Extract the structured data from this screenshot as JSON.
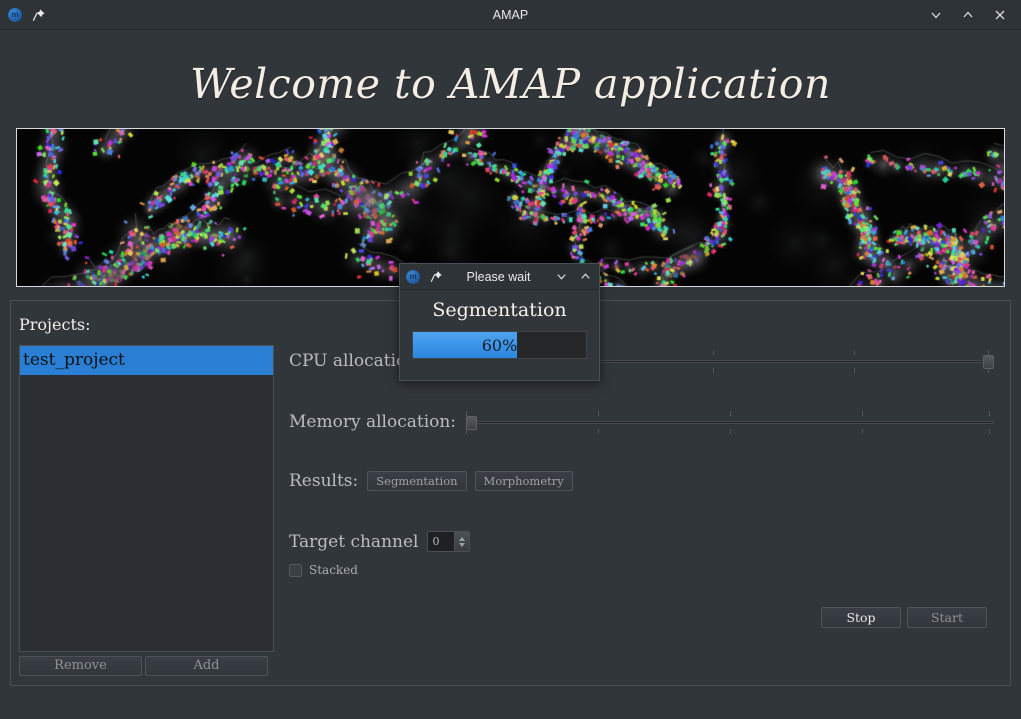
{
  "window": {
    "title": "AMAP",
    "app_icon": "app-logo-icon",
    "pin_icon": "pin-icon",
    "controls": [
      {
        "name": "minimize",
        "icon": "chevron-down-icon"
      },
      {
        "name": "maximize",
        "icon": "chevron-up-icon"
      },
      {
        "name": "close",
        "icon": "close-icon"
      }
    ]
  },
  "welcome": {
    "heading": "Welcome to AMAP application"
  },
  "banner": {
    "alt": "segmented-microscopy-preview"
  },
  "projects": {
    "label": "Projects:",
    "items": [
      {
        "name": "test_project",
        "selected": true
      }
    ],
    "remove_label": "Remove",
    "add_label": "Add"
  },
  "controls": {
    "cpu_label": "CPU allocation:",
    "cpu_value": 100,
    "memory_label": "Memory allocation:",
    "memory_value": 0,
    "results_label": "Results:",
    "results_buttons": [
      {
        "label": "Segmentation"
      },
      {
        "label": "Morphometry"
      }
    ],
    "target_channel_label": "Target channel",
    "target_channel_value": "0",
    "stacked_label": "Stacked",
    "stacked_checked": false,
    "stop_label": "Stop",
    "start_label": "Start"
  },
  "modal": {
    "title": "Please wait",
    "app_icon": "app-logo-icon",
    "pin_icon": "pin-icon",
    "heading": "Segmentation",
    "progress_text": "60%",
    "progress_percent": 60,
    "controls": [
      {
        "name": "minimize",
        "icon": "chevron-down-icon"
      },
      {
        "name": "maximize",
        "icon": "chevron-up-icon"
      }
    ]
  },
  "colors": {
    "accent": "#2a7fd4",
    "progress": "#3d93e8",
    "background": "#31363b",
    "titlebar": "#2e3338"
  }
}
